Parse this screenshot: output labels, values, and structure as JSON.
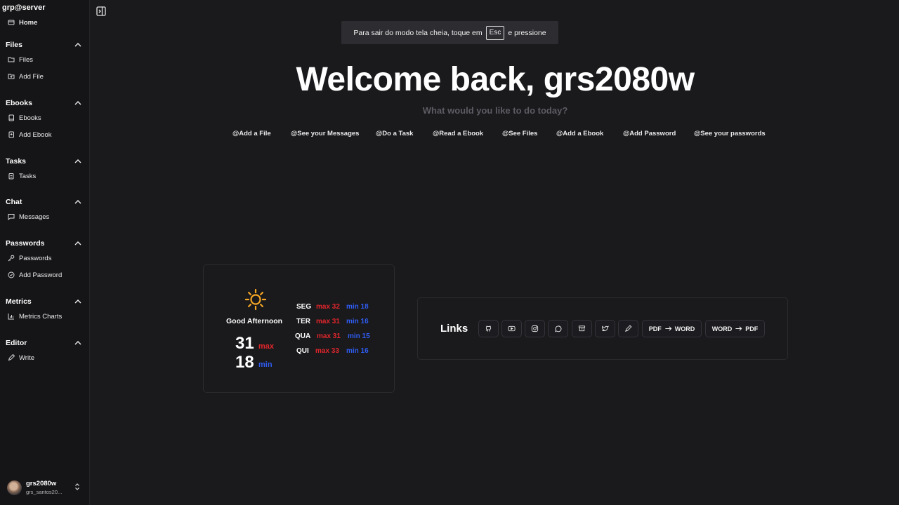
{
  "sidebar": {
    "brand": "grp@server",
    "home": "Home",
    "groups": [
      {
        "label": "Files",
        "items": [
          "Files",
          "Add File"
        ]
      },
      {
        "label": "Ebooks",
        "items": [
          "Ebooks",
          "Add Ebook"
        ]
      },
      {
        "label": "Tasks",
        "items": [
          "Tasks"
        ]
      },
      {
        "label": "Chat",
        "items": [
          "Messages"
        ]
      },
      {
        "label": "Passwords",
        "items": [
          "Passwords",
          "Add Password"
        ]
      },
      {
        "label": "Metrics",
        "items": [
          "Metrics Charts"
        ]
      },
      {
        "label": "Editor",
        "items": [
          "Write"
        ]
      }
    ],
    "user": {
      "name": "grs2080w",
      "email": "grs_santos20..."
    }
  },
  "fullscreen_notice": {
    "before": "Para sair do modo tela cheia, toque em",
    "key": "Esc",
    "after": "e pressione"
  },
  "main": {
    "welcome": "Welcome back, grs2080w",
    "subtitle": "What would you like to do today?",
    "quick_actions": [
      "@Add a File",
      "@See your Messages",
      "@Do a Task",
      "@Read a Ebook",
      "@See Files",
      "@Add a Ebook",
      "@Add Password",
      "@See your passwords"
    ]
  },
  "weather": {
    "greeting": "Good Afternoon",
    "max_value": "31",
    "max_label": "max",
    "min_value": "18",
    "min_label": "min",
    "forecast": [
      {
        "day": "SEG",
        "max": "max 32",
        "min": "min 18"
      },
      {
        "day": "TER",
        "max": "max 31",
        "min": "min 16"
      },
      {
        "day": "QUA",
        "max": "max 31",
        "min": "min 15"
      },
      {
        "day": "QUI",
        "max": "max 33",
        "min": "min 16"
      }
    ],
    "colors": {
      "max": "#e0262b",
      "min": "#2f5df2",
      "sun": "#f5a623"
    }
  },
  "links": {
    "title": "Links",
    "icons": [
      "github-icon",
      "youtube-icon",
      "instagram-icon",
      "whatsapp-icon",
      "archive-icon",
      "twitter-icon",
      "pencil-icon"
    ],
    "pdf_to_word": {
      "from": "PDF",
      "to": "WORD"
    },
    "word_to_pdf": {
      "from": "WORD",
      "to": "PDF"
    }
  }
}
